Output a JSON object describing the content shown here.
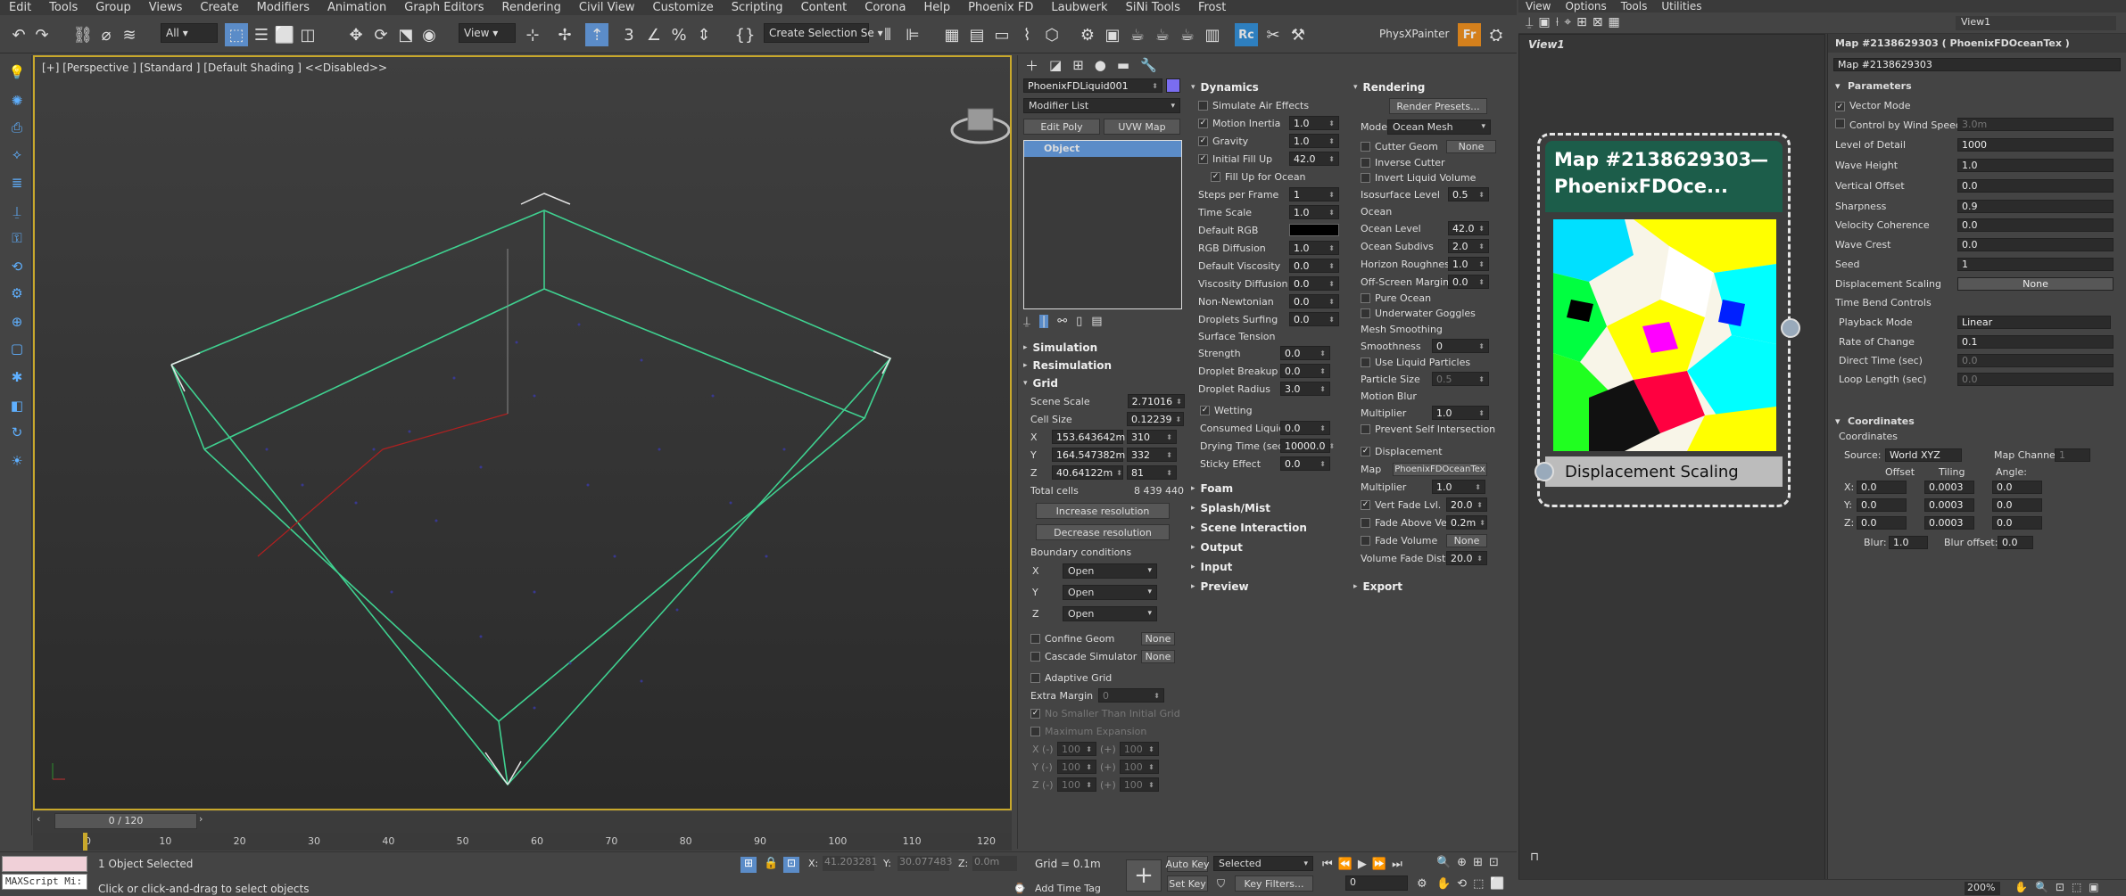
{
  "menu": [
    "Edit",
    "Tools",
    "Group",
    "Views",
    "Create",
    "Modifiers",
    "Animation",
    "Graph Editors",
    "Rendering",
    "Civil View",
    "Customize",
    "Scripting",
    "Content",
    "Corona",
    "Help",
    "Phoenix FD",
    "Laubwerk",
    "SiNi Tools",
    "Frost"
  ],
  "toolbar": {
    "filter": "All",
    "ref_coord": "View",
    "selection_set": "Create Selection Se",
    "physx": "PhysXPainter",
    "rc": "Rc",
    "fr": "Fr"
  },
  "viewport": {
    "label": "[+] [Perspective ] [Standard ] [Default Shading ] <<Disabled>>"
  },
  "timeline": {
    "frame": "0 / 120",
    "ticks": [
      "0",
      "10",
      "20",
      "30",
      "40",
      "50",
      "60",
      "70",
      "80",
      "90",
      "100",
      "110",
      "120"
    ]
  },
  "status": {
    "selected": "1 Object Selected",
    "prompt": "Click or click-and-drag to select objects",
    "script": "MAXScript Mi:",
    "x_label": "X:",
    "x_val": "41.203281",
    "y_label": "Y:",
    "y_val": "30.077483",
    "z_label": "Z:",
    "z_val": "0.0m",
    "grid": "Grid = 0.1m",
    "add_time_tag": "Add Time Tag",
    "auto_key": "Auto Key",
    "set_key": "Set Key",
    "selected_dd": "Selected",
    "key_filters": "Key Filters...",
    "frame_field": "0"
  },
  "cmd": {
    "object_name": "PhoenixFDLiquid001",
    "modifier_list": "Modifier List",
    "edit_poly": "Edit Poly",
    "uvw_map": "UVW Map",
    "stack_item": "Object",
    "simulation": "Simulation",
    "resimulation": "Resimulation",
    "grid": "Grid",
    "scene_scale_label": "Scene Scale",
    "scene_scale": "2.71016",
    "cell_size_label": "Cell Size",
    "cell_size": "0.12239",
    "x_label": "X",
    "x_size": "153.643642m",
    "x_cells": "310",
    "y_label": "Y",
    "y_size": "164.547382m",
    "y_cells": "332",
    "z_label": "Z",
    "z_size": "40.64122m",
    "z_cells": "81",
    "total_cells_label": "Total cells",
    "total_cells": "8 439 440",
    "increase_res": "Increase resolution",
    "decrease_res": "Decrease resolution",
    "boundary": "Boundary conditions",
    "bx": "Open",
    "by": "Open",
    "bz": "Open",
    "confine_geom": "Confine Geom",
    "confine_val": "None",
    "cascade_sim": "Cascade Simulator",
    "cascade_val": "None",
    "adaptive_grid": "Adaptive Grid",
    "extra_margin": "Extra Margin",
    "extra_margin_val": "0",
    "no_smaller": "No Smaller Than Initial Grid",
    "max_expansion": "Maximum Expansion",
    "xm": "X (-)",
    "ym": "Y (-)",
    "zm": "Z (-)",
    "plus": "(+)",
    "hundred": "100",
    "dynamics": "Dynamics",
    "simulate_air": "Simulate Air Effects",
    "motion_inertia": "Motion Inertia",
    "motion_inertia_val": "1.0",
    "gravity": "Gravity",
    "gravity_val": "1.0",
    "initial_fill": "Initial Fill Up",
    "initial_fill_val": "42.0",
    "fill_ocean": "Fill Up for Ocean",
    "steps_per_frame": "Steps per Frame",
    "steps_val": "1",
    "time_scale": "Time Scale",
    "time_scale_val": "1.0",
    "default_rgb": "Default RGB",
    "rgb_diffusion": "RGB Diffusion",
    "rgb_diffusion_val": "1.0",
    "default_viscosity": "Default Viscosity",
    "default_viscosity_val": "0.0",
    "viscosity_diffusion": "Viscosity Diffusion",
    "viscosity_diffusion_val": "0.0",
    "non_newtonian": "Non-Newtonian",
    "non_newtonian_val": "0.0",
    "droplets_surfing": "Droplets Surfing",
    "droplets_surfing_val": "0.0",
    "surface_tension": "Surface Tension",
    "strength": "Strength",
    "strength_val": "0.0",
    "droplet_breakup": "Droplet Breakup",
    "droplet_breakup_val": "0.0",
    "droplet_radius": "Droplet Radius",
    "droplet_radius_val": "3.0",
    "wetting": "Wetting",
    "consumed_liquid": "Consumed Liquid",
    "consumed_liquid_val": "0.0",
    "drying_time": "Drying Time (sec)",
    "drying_time_val": "10000.0",
    "sticky_effect": "Sticky Effect",
    "sticky_effect_val": "0.0",
    "foam": "Foam",
    "splash": "Splash/Mist",
    "scene_interaction": "Scene Interaction",
    "output": "Output",
    "input": "Input",
    "preview": "Preview",
    "rendering": "Rendering",
    "render_presets": "Render Presets...",
    "mode": "Mode",
    "mode_val": "Ocean Mesh",
    "cutter_geom": "Cutter Geom",
    "cutter_val": "None",
    "inverse_cutter": "Inverse Cutter",
    "invert_liquid": "Invert Liquid Volume",
    "isosurface": "Isosurface Level",
    "isosurface_val": "0.5",
    "ocean": "Ocean",
    "ocean_level": "Ocean Level",
    "ocean_level_val": "42.0",
    "ocean_subdivs": "Ocean Subdivs",
    "ocean_subdivs_val": "2.0",
    "horizon_roughness": "Horizon Roughness",
    "horizon_roughness_val": "1.0",
    "offscreen_margin": "Off-Screen Margin",
    "offscreen_margin_val": "0.0",
    "pure_ocean": "Pure Ocean",
    "underwater_goggles": "Underwater Goggles",
    "mesh_smoothing": "Mesh Smoothing",
    "smoothness": "Smoothness",
    "smoothness_val": "0",
    "use_liquid_particles": "Use Liquid Particles",
    "particle_size": "Particle Size",
    "particle_size_val": "0.5",
    "motion_blur": "Motion Blur",
    "multiplier": "Multiplier",
    "multiplier_val": "1.0",
    "prevent_self": "Prevent Self Intersection",
    "displacement": "Displacement",
    "map_label": "Map",
    "map_val": "PhoenixFDOceanTex",
    "disp_multiplier_val": "1.0",
    "vert_fade": "Vert Fade Lvl.",
    "vert_fade_val": "20.0",
    "fade_above": "Fade Above Vel.",
    "fade_above_val": "0.2m",
    "fade_volume": "Fade Volume",
    "fade_volume_val": "None",
    "volume_fade_dist": "Volume Fade Dist",
    "volume_fade_dist_val": "20.0",
    "export": "Export"
  },
  "right": {
    "menu": [
      "View",
      "Options",
      "Tools",
      "Utilities"
    ],
    "view_tab": "View1",
    "view_title": "View1",
    "node_title1": "Map #2138629303",
    "node_title2": "PhoenixFDOce...",
    "node_footer": "Displacement Scaling",
    "param_title": "Map #2138629303  ( PhoenixFDOceanTex )",
    "param_name": "Map #2138629303",
    "parameters": "Parameters",
    "vector_mode": "Vector Mode",
    "control_wind": "Control by Wind Speed",
    "control_wind_val": "3.0m",
    "level_of_detail": "Level of Detail",
    "level_of_detail_val": "1000",
    "wave_height": "Wave Height",
    "wave_height_val": "1.0",
    "vertical_offset": "Vertical Offset",
    "vertical_offset_val": "0.0",
    "sharpness": "Sharpness",
    "sharpness_val": "0.9",
    "velocity_coherence": "Velocity Coherence",
    "velocity_coherence_val": "0.0",
    "wave_crest": "Wave Crest",
    "wave_crest_val": "0.0",
    "seed": "Seed",
    "seed_val": "1",
    "displacement_scaling": "Displacement Scaling",
    "displacement_scaling_val": "None",
    "time_bend": "Time Bend Controls",
    "playback_mode": "Playback Mode",
    "playback_mode_val": "Linear",
    "rate_of_change": "Rate of Change",
    "rate_of_change_val": "0.1",
    "direct_time": "Direct Time (sec)",
    "direct_time_val": "0.0",
    "loop_length": "Loop Length (sec)",
    "loop_length_val": "0.0",
    "coordinates_sec": "Coordinates",
    "coordinates": "Coordinates",
    "source": "Source:",
    "source_val": "World XYZ",
    "map_channel": "Map Channel:",
    "map_channel_val": "1",
    "offset": "Offset",
    "tiling": "Tiling",
    "angle": "Angle:",
    "cx": "X:",
    "cy": "Y:",
    "cz": "Z:",
    "off_x": "0.0",
    "off_y": "0.0",
    "off_z": "0.0",
    "til_x": "0.0003",
    "til_y": "0.0003",
    "til_z": "0.0003",
    "ang_x": "0.0",
    "ang_y": "0.0",
    "ang_z": "0.0",
    "blur": "Blur:",
    "blur_val": "1.0",
    "blur_offset": "Blur offset:",
    "blur_offset_val": "0.0",
    "zoom": "200%"
  },
  "colors": {
    "accent": "#5fb0ff",
    "node_header": "#1c5d4a",
    "selection": "#5b8cc8",
    "viewport_border": "#c8a82c"
  }
}
